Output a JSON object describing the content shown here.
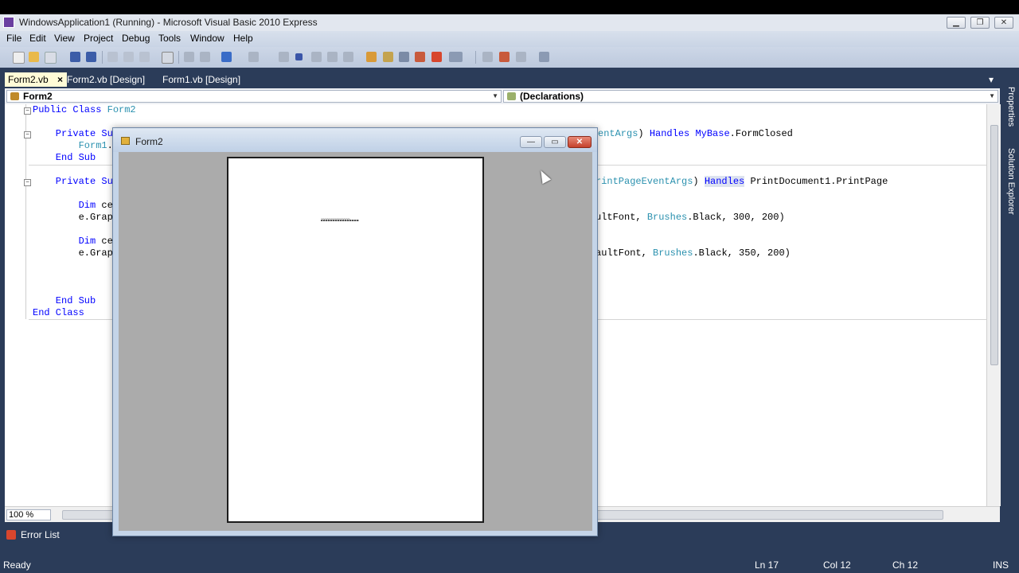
{
  "window": {
    "title": "WindowsApplication1 (Running) - Microsoft Visual Basic 2010 Express",
    "controls": {
      "minimize": "▁",
      "restore": "❐",
      "close": "✕"
    }
  },
  "menu": [
    "File",
    "Edit",
    "View",
    "Project",
    "Debug",
    "Tools",
    "Window",
    "Help"
  ],
  "tabs": [
    {
      "label": "Form2.vb",
      "active": true,
      "close": "×"
    },
    {
      "label": "Form2.vb [Design]",
      "active": false
    },
    {
      "label": "Form1.vb [Design]",
      "active": false
    }
  ],
  "tab_overflow": "▾",
  "navbar": {
    "class_combo": "Form2",
    "member_combo": "(Declarations)"
  },
  "code_lines": [
    "Public Class Form2",
    "",
    "    Private Sub",
    "        Form1.S",
    "    End Sub",
    "",
    "    Private Sub",
    "",
    "        Dim ce",
    "        e.Graph",
    "",
    "        Dim ce1",
    "        e.Graph",
    "",
    "",
    "",
    "    End Sub",
    "End Class"
  ],
  "code_right": {
    "line3": "entArgs) Handles MyBase.FormClosed",
    "line7": "rintPageEventArgs) Handles PrintDocument1.PrintPage",
    "line10": "ultFont, Brushes.Black, 300, 200)",
    "line13": "aultFont, Brushes.Black, 350, 200)"
  },
  "zoom": "100 %",
  "side_panels": [
    "Properties",
    "Solution Explorer"
  ],
  "error_list": "Error List",
  "status": {
    "text": "Ready",
    "ln": "Ln 17",
    "col": "Col 12",
    "ch": "Ch 12",
    "mode": "INS"
  },
  "form2": {
    "title": "Form2",
    "controls": {
      "minimize": "—",
      "maximize": "▭",
      "close": "✕"
    },
    "preview_text": "~~~~~~~~~~~~~~~"
  },
  "colors": {
    "accent": "#2b3c59",
    "keyword": "#0000ff",
    "type": "#2b91af",
    "active_tab": "#fffbd7"
  }
}
